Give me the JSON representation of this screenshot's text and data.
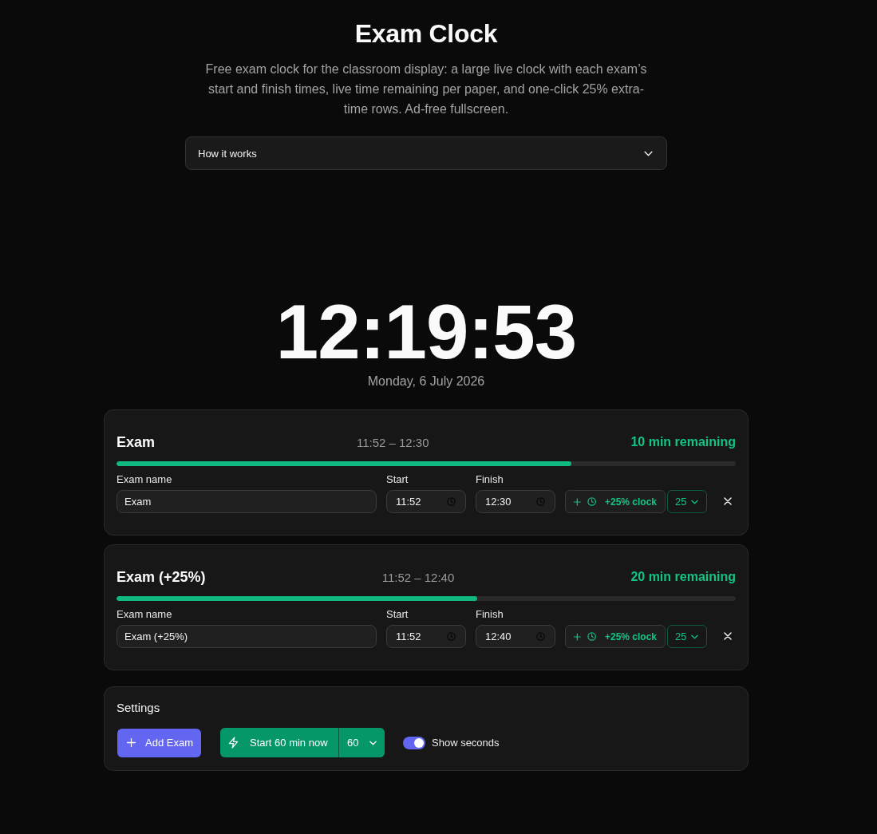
{
  "header": {
    "title": "Exam Clock",
    "description": "Free exam clock for the classroom display: a large live clock with each exam’s start and finish times, live time remaining per paper, and one-click 25% extra-time rows. Ad-free fullscreen."
  },
  "accordion": {
    "label": "How it works",
    "expanded": false
  },
  "clock": {
    "time": "12:19:53",
    "date": "Monday, 6 July 2026"
  },
  "exams": [
    {
      "title": "Exam",
      "times": "11:52 – 12:30",
      "remaining": "10 min remaining",
      "level": 0.734,
      "name_label": "Exam name",
      "name_value": "Exam",
      "start_label": "Start",
      "start_value": "11:52",
      "finish_label": "Finish",
      "finish_value": "12:30",
      "extra_button": "+25% clock",
      "extra_percent": "25"
    },
    {
      "title": "Exam (+25%)",
      "times": "11:52 – 12:40",
      "remaining": "20 min remaining",
      "level": 0.583,
      "name_label": "Exam name",
      "name_value": "Exam (+25%)",
      "start_label": "Start",
      "start_value": "11:52",
      "finish_label": "Finish",
      "finish_value": "12:40",
      "extra_button": "+25% clock",
      "extra_percent": "25"
    }
  ],
  "settings": {
    "title": "Settings",
    "add_button": "Add Exam",
    "start_button": "Start 60 min now",
    "duration": "60",
    "toggle": {
      "label": "Show seconds",
      "on": true
    }
  }
}
